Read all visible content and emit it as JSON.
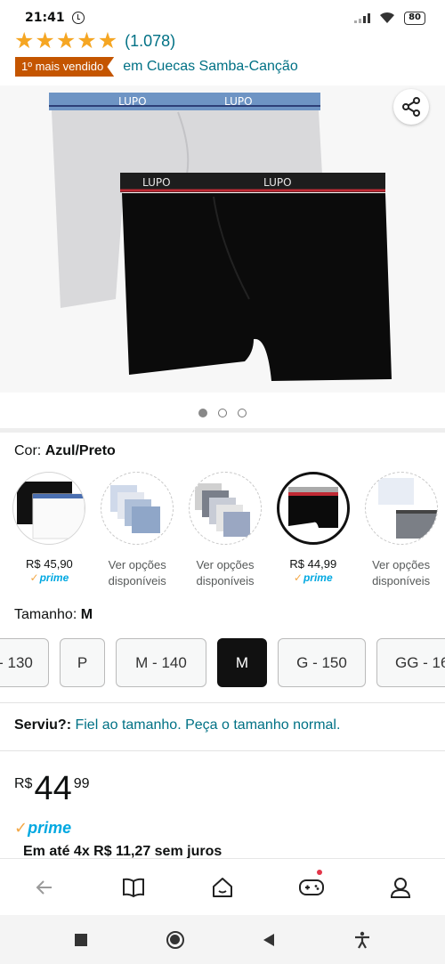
{
  "status_bar": {
    "time": "21:41",
    "battery": "80"
  },
  "rating": {
    "stars": 5,
    "count": "(1.078)"
  },
  "best_seller": {
    "badge": "1º mais vendido",
    "category": "em Cuecas Samba-Canção"
  },
  "product_image": {
    "brand_logo": "LUPO",
    "page_indicator": {
      "total": 3,
      "active": 0
    }
  },
  "color": {
    "label": "Cor:",
    "selected": "Azul/Preto",
    "swatches": [
      {
        "price": "R$ 45,90",
        "prime": "prime",
        "options": ""
      },
      {
        "price": "",
        "prime": "",
        "options_line1": "Ver opções",
        "options_line2": "disponíveis"
      },
      {
        "price": "",
        "prime": "",
        "options_line1": "Ver opções",
        "options_line2": "disponíveis"
      },
      {
        "price": "R$ 44,99",
        "prime": "prime",
        "options": ""
      },
      {
        "price": "",
        "prime": "",
        "options_line1": "Ver opções",
        "options_line2": "disponíveis"
      }
    ]
  },
  "size": {
    "label": "Tamanho:",
    "selected": "M",
    "options": [
      "- 130",
      "P",
      "M - 140",
      "M",
      "G - 150",
      "GG - 16"
    ]
  },
  "fit": {
    "label": "Serviu?:",
    "text": "Fiel ao tamanho. Peça o tamanho normal."
  },
  "price": {
    "currency": "R$",
    "whole": "44",
    "cents": "99"
  },
  "prime": {
    "label": "prime"
  },
  "installments": "Em até 4x R$ 11,27 sem juros",
  "colors": {
    "link": "#007185",
    "badge": "#c45500",
    "star": "#f5a623",
    "prime": "#00a8e1"
  },
  "app_nav": [
    "back-icon",
    "book-icon",
    "home-icon",
    "gamepad-icon",
    "account-icon"
  ],
  "system_nav": [
    "recents-icon",
    "home-icon",
    "back-icon",
    "accessibility-icon"
  ]
}
